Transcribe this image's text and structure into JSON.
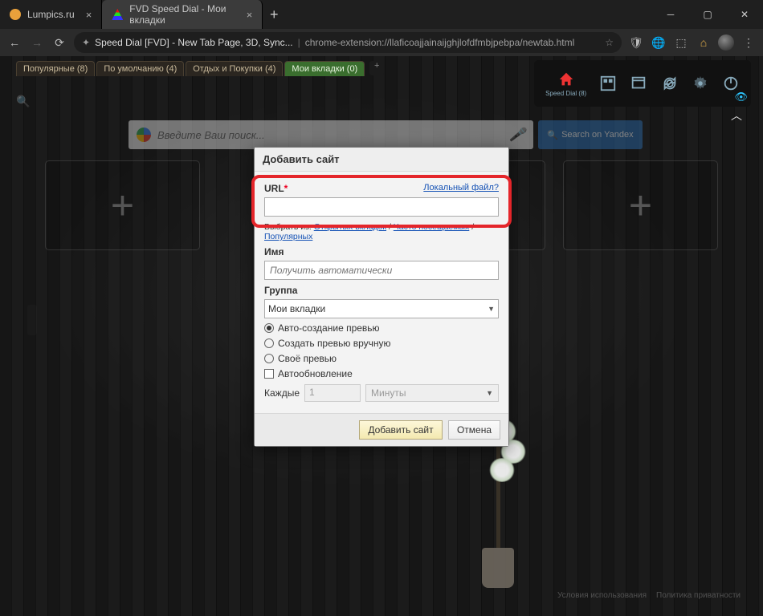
{
  "window": {
    "tab1": "Lumpics.ru",
    "tab2": "FVD Speed Dial - Мои вкладки"
  },
  "addr": {
    "title": "Speed Dial [FVD] - New Tab Page, 3D, Sync...",
    "url": "chrome-extension://llaficoajjainaijghjlofdfmbjpebpa/newtab.html"
  },
  "groups": {
    "g1": "Популярные (8)",
    "g2": "По умолчанию (4)",
    "g3": "Отдых и Покупки (4)",
    "g4": "Мои вкладки (0)"
  },
  "util": {
    "speed_dial": "Speed Dial (8)"
  },
  "search": {
    "placeholder": "Введите Ваш поиск...",
    "yandex": "Search on Yandex"
  },
  "footer": {
    "terms": "Условия использования",
    "privacy": "Политика приватности"
  },
  "dialog": {
    "title": "Добавить сайт",
    "url_label": "URL",
    "local_file": "Локальный файл?",
    "pick_prefix": "Выбрать из:",
    "pick_open": "Открытых вкладок",
    "pick_freq": "Часто посещаемых",
    "pick_pop": "Популярных",
    "name_label": "Имя",
    "name_placeholder": "Получить автоматически",
    "group_label": "Группа",
    "group_value": "Мои вкладки",
    "r1": "Авто-создание превью",
    "r2": "Создать превью вручную",
    "r3": "Своё превью",
    "cb": "Автообновление",
    "every": "Каждые",
    "int_val": "1",
    "unit": "Минуты",
    "ok": "Добавить сайт",
    "cancel": "Отмена"
  }
}
